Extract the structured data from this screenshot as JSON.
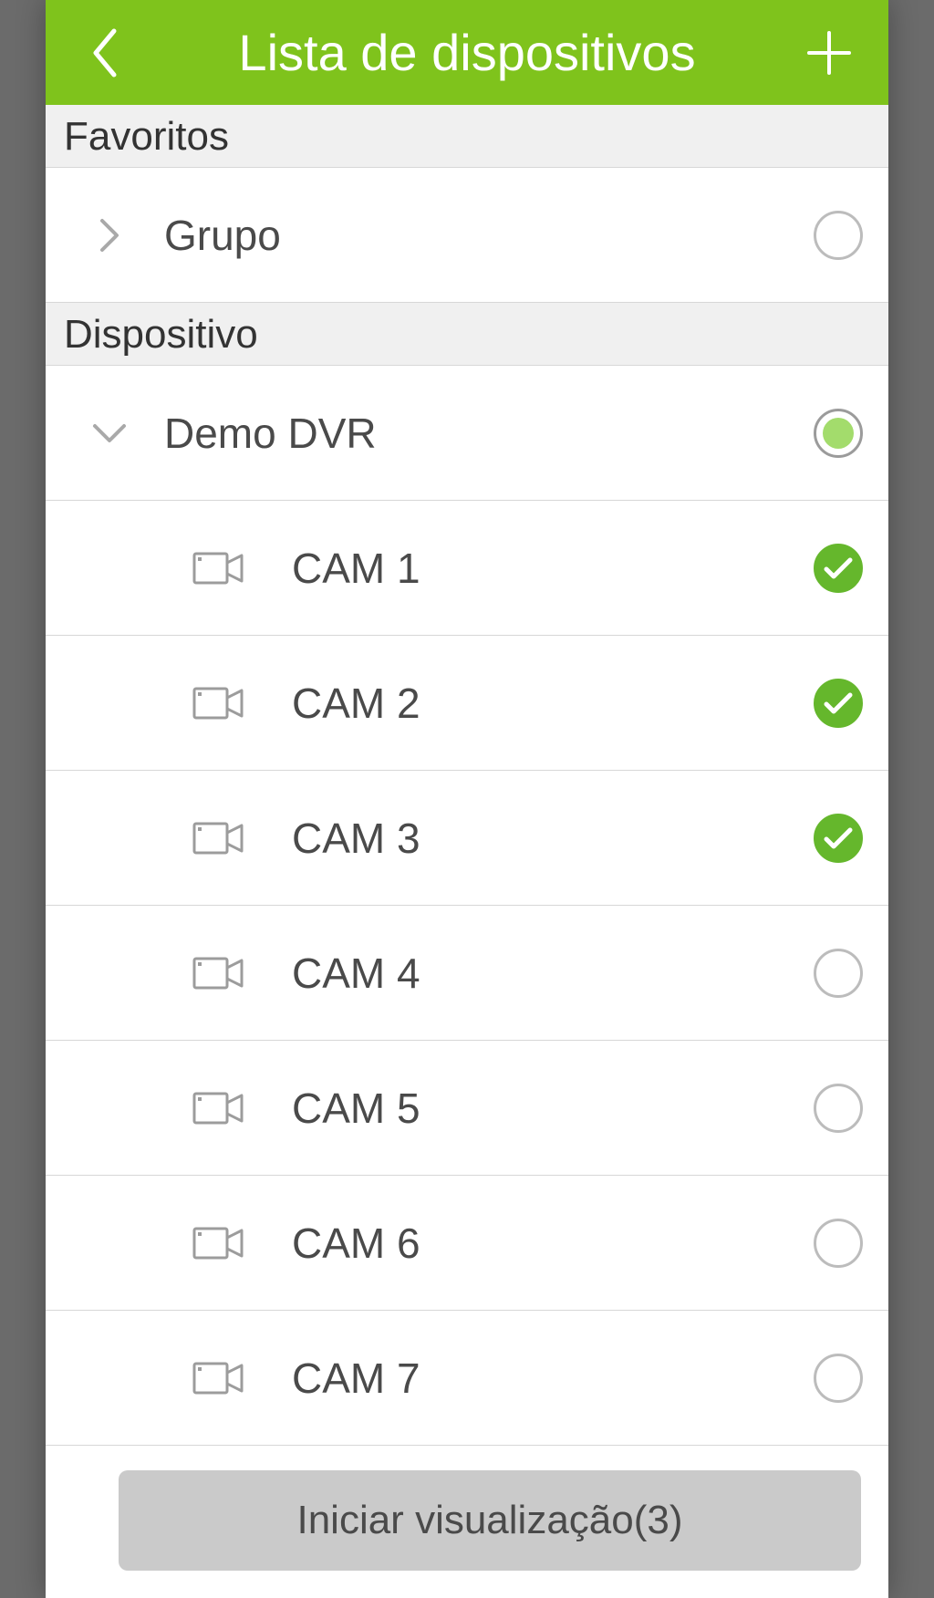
{
  "header": {
    "title": "Lista de dispositivos"
  },
  "sections": {
    "favorites": {
      "title": "Favoritos",
      "group_label": "Grupo"
    },
    "device": {
      "title": "Dispositivo",
      "device_name": "Demo DVR"
    }
  },
  "cameras": [
    {
      "name": "CAM 1",
      "selected": true
    },
    {
      "name": "CAM 2",
      "selected": true
    },
    {
      "name": "CAM 3",
      "selected": true
    },
    {
      "name": "CAM 4",
      "selected": false
    },
    {
      "name": "CAM 5",
      "selected": false
    },
    {
      "name": "CAM 6",
      "selected": false
    },
    {
      "name": "CAM 7",
      "selected": false
    }
  ],
  "footer": {
    "start_label": "Iniciar visualização(3)"
  }
}
